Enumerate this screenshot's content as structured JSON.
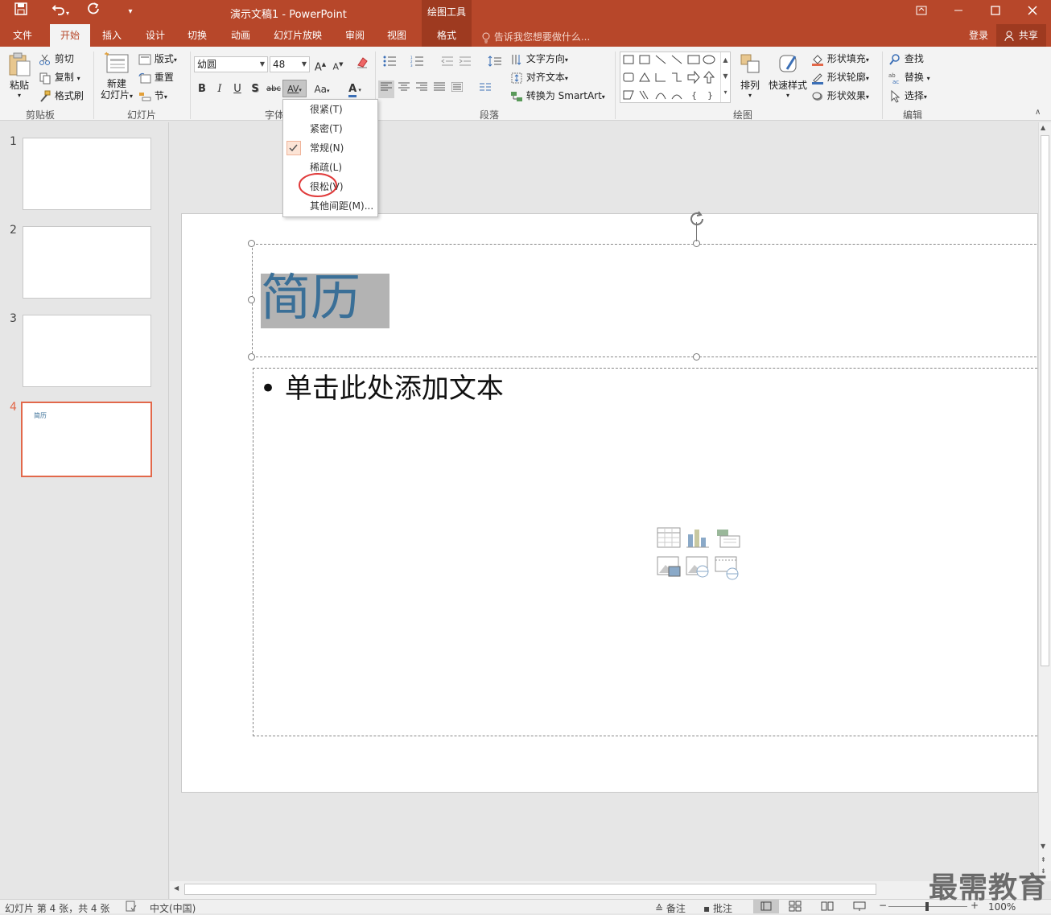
{
  "qat": {
    "save": "save-icon",
    "undo": "undo-icon",
    "redo": "redo-icon",
    "customize": "▾"
  },
  "title": "演示文稿1 - PowerPoint",
  "context_tool": "绘图工具",
  "tabs": [
    "文件",
    "开始",
    "插入",
    "设计",
    "切换",
    "动画",
    "幻灯片放映",
    "审阅",
    "视图",
    "格式"
  ],
  "tell_me": "告诉我您想要做什么...",
  "login": "登录",
  "share": "共享",
  "clipboard": {
    "paste": "粘贴",
    "cut": "剪切",
    "copy": "复制",
    "format_painter": "格式刷",
    "label": "剪贴板"
  },
  "slides": {
    "new_slide_line1": "新建",
    "new_slide_line2": "幻灯片",
    "layout": "版式",
    "reset": "重置",
    "section": "节",
    "label": "幻灯片"
  },
  "font": {
    "name": "幼圆",
    "size": "48",
    "bold": "B",
    "italic": "I",
    "underline": "U",
    "shadow": "S",
    "strike": "abc",
    "spacing": "AV",
    "case": "Aa",
    "color_letter": "A",
    "label": "字体"
  },
  "paragraph": {
    "text_direction": "文字方向",
    "align_text": "对齐文本",
    "smartart": "转换为 SmartArt",
    "label": "段落"
  },
  "drawing": {
    "arrange": "排列",
    "quick_styles": "快速样式",
    "shape_fill": "形状填充",
    "shape_outline": "形状轮廓",
    "shape_effects": "形状效果",
    "label": "绘图"
  },
  "editing": {
    "find": "查找",
    "replace": "替换",
    "select": "选择",
    "label": "编辑"
  },
  "spacing_menu": [
    {
      "label": "很紧(T)",
      "checked": false
    },
    {
      "label": "紧密(T)",
      "checked": false
    },
    {
      "label": "常规(N)",
      "checked": true
    },
    {
      "label": "稀疏(L)",
      "checked": false
    },
    {
      "label": "很松(V)",
      "checked": false
    },
    {
      "label": "其他间距(M)...",
      "checked": false
    }
  ],
  "slide_list": [
    {
      "num": "1",
      "title": ""
    },
    {
      "num": "2",
      "title": ""
    },
    {
      "num": "3",
      "title": ""
    },
    {
      "num": "4",
      "title": "简历"
    }
  ],
  "slide": {
    "title": "简历",
    "body_placeholder": "单击此处添加文本"
  },
  "status": {
    "slide_info": "幻灯片 第 4 张，共 4 张",
    "language": "中文(中国)",
    "notes": "备注",
    "comments": "批注",
    "zoom": "100%"
  },
  "watermark": "最需教育",
  "colors": {
    "accent": "#b7472a",
    "title_text": "#3a6f97",
    "selection": "#b3b3b3",
    "annotation": "#e03a3a"
  }
}
